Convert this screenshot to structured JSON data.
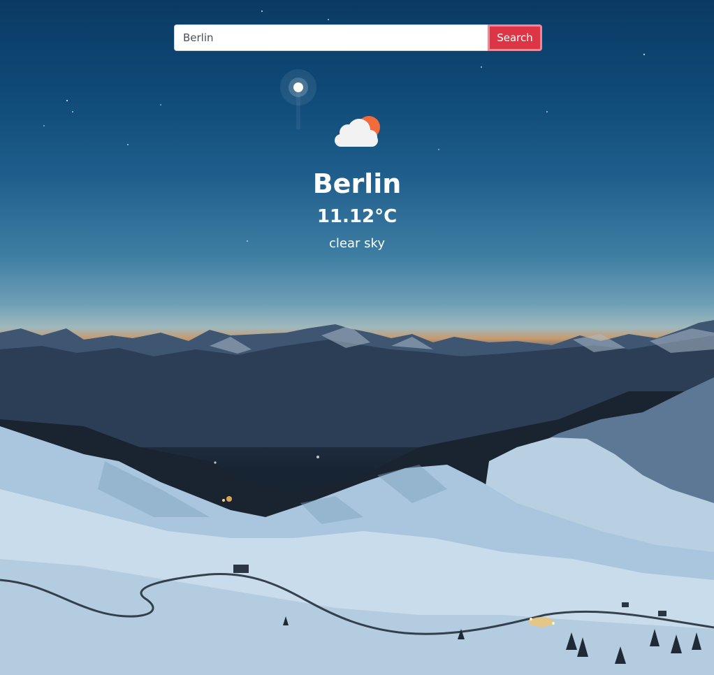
{
  "search": {
    "value": "Berlin",
    "button_label": "Search"
  },
  "weather": {
    "icon": "cloud-sun-icon",
    "city": "Berlin",
    "temperature": "11.12°C",
    "description": "clear sky"
  },
  "colors": {
    "search_button": "#dc3545",
    "sun": "#f26b3a",
    "cloud": "#f2f2f2",
    "text": "#ffffff"
  }
}
